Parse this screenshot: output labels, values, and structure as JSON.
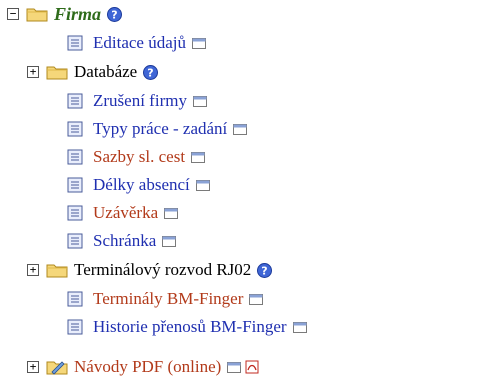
{
  "tree": {
    "root": {
      "label": "Firma",
      "toggle": "−"
    },
    "items": [
      {
        "key": "editace",
        "label": "Editace údajů"
      },
      {
        "key": "databaze",
        "label": "Databáze",
        "toggle": "+"
      },
      {
        "key": "zruseni",
        "label": "Zrušení firmy"
      },
      {
        "key": "typy",
        "label": "Typy práce - zadání"
      },
      {
        "key": "sazby",
        "label": "Sazby sl. cest"
      },
      {
        "key": "delky",
        "label": "Délky absencí"
      },
      {
        "key": "uzaverka",
        "label": "Uzávěrka"
      },
      {
        "key": "schranka",
        "label": "Schránka"
      },
      {
        "key": "terminalovy",
        "label": "Terminálový rozvod RJ02",
        "toggle": "+"
      },
      {
        "key": "terminaly",
        "label": "Terminály BM-Finger"
      },
      {
        "key": "historie",
        "label": "Historie přenosů BM-Finger"
      },
      {
        "key": "navody",
        "label": "Návody PDF (online)",
        "toggle": "+"
      }
    ]
  },
  "colors": {
    "link": "#1f2fb0",
    "visited": "#b23a1a",
    "root": "#2e6b1a"
  },
  "icons": {
    "folder": "folder-icon",
    "document": "document-icon",
    "help": "help-icon",
    "window": "new-window-icon",
    "pdf": "pdf-icon"
  }
}
